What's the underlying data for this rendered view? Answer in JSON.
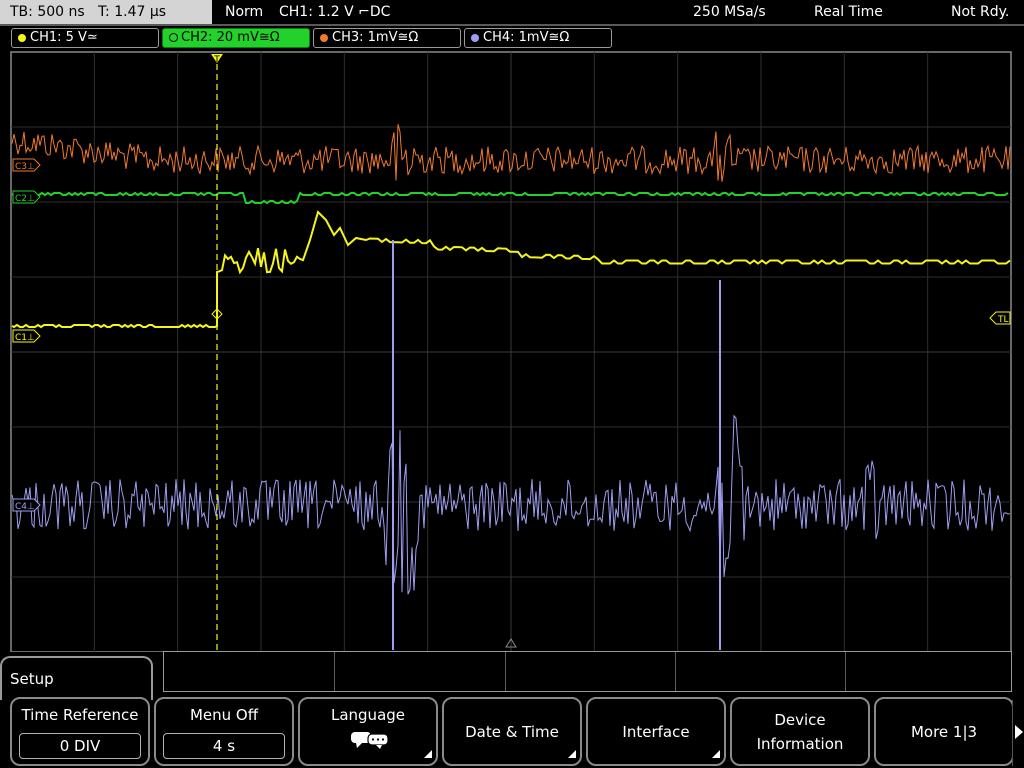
{
  "status_bar": {
    "timebase": "TB: 500 ns",
    "trigger_time": "T: 1.47 µs",
    "mode": "Norm",
    "trigger": "CH1: 1.2 V ⌐DC",
    "sample_rate": "250 MSa/s",
    "acq_mode": "Real Time",
    "state": "Not Rdy."
  },
  "channels": [
    {
      "label": "CH1: 5 V≃",
      "color": "#f5f51a",
      "active": false
    },
    {
      "label": "CH2: 20 mV≅Ω",
      "color": "#22d12a",
      "active": true
    },
    {
      "label": "CH3: 1mV≅Ω",
      "color": "#f07a2e",
      "active": false
    },
    {
      "label": "CH4: 1mV≅Ω",
      "color": "#9d9ef0",
      "active": false
    }
  ],
  "markers": {
    "c3": "C3⊥",
    "c2": "C2⊥",
    "c1": "C1⊥",
    "c4": "C4⊥",
    "trigger_level": "TL",
    "trigger_pos": "T"
  },
  "menu": {
    "title": "Setup",
    "softkeys": [
      {
        "label": "Time Reference",
        "value": "0 DIV"
      },
      {
        "label": "Menu Off",
        "value": "4 s"
      },
      {
        "label": "Language",
        "icon": "speech-bubbles-icon"
      },
      {
        "label": "Date & Time"
      },
      {
        "label": "Interface"
      },
      {
        "label_line1": "Device",
        "label_line2": "Information"
      },
      {
        "label": "More 1|3"
      }
    ]
  }
}
